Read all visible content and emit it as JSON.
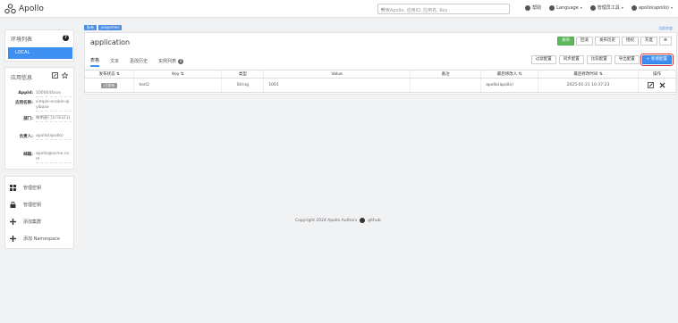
{
  "navbar": {
    "brand": "Apollo",
    "search_placeholder": "搜索Apollo, 应用ID, 应用名, Key",
    "links": [
      {
        "icon": "help-icon",
        "label": "帮助"
      },
      {
        "icon": "globe-icon",
        "label": "Language"
      },
      {
        "icon": "gear-icon",
        "label": "管理员工具"
      },
      {
        "icon": "user-icon",
        "label": "apollo(apollo)"
      }
    ]
  },
  "sidebar": {
    "env": {
      "title": "环境列表",
      "items": [
        "LOCAL"
      ]
    },
    "info": {
      "title": "应用信息",
      "rows": [
        {
          "key": "AppId:",
          "value": "1000044xxx"
        },
        {
          "key": "应用名称:",
          "value": "simple-enable-qiyibase"
        },
        {
          "key": "部门:",
          "value": "样例部门1(TEST1)"
        },
        {
          "key": "负责人:",
          "value": "apollo(apollo)"
        },
        {
          "key": "邮箱:",
          "value": "apollo@acme.com"
        }
      ]
    },
    "menu": [
      {
        "icon": "grid-icon",
        "label": "管理密钥"
      },
      {
        "icon": "lock-icon",
        "label": "管理密钥"
      },
      {
        "icon": "plus-icon",
        "label": "添加集群"
      },
      {
        "icon": "plus-icon",
        "label": "添加 Namespace"
      }
    ]
  },
  "main": {
    "tags": [
      "私有",
      "properties"
    ],
    "release_tag": "当前灰度",
    "title": "application",
    "top_buttons": [
      {
        "label": "发布",
        "style": "green"
      },
      {
        "label": "回滚",
        "style": "default"
      },
      {
        "label": "发布历史",
        "style": "default"
      },
      {
        "label": "授权",
        "style": "default"
      },
      {
        "label": "灰度",
        "style": "default"
      },
      {
        "label": "⚙",
        "style": "default"
      }
    ],
    "tabs": [
      {
        "label": "表格",
        "active": true
      },
      {
        "label": "文本",
        "active": false
      },
      {
        "label": "更改历史",
        "active": false
      },
      {
        "label": "实例列表",
        "active": false,
        "badge": "0"
      }
    ],
    "tab_buttons": [
      {
        "label": "过滤配置",
        "style": "default"
      },
      {
        "label": "同步配置",
        "style": "default"
      },
      {
        "label": "比较配置",
        "style": "default"
      },
      {
        "label": "导出配置",
        "style": "default"
      },
      {
        "label": "+ 新增配置",
        "style": "blue"
      }
    ],
    "table": {
      "headers": [
        "发布状态 ⇅",
        "Key ⇅",
        "类型",
        "Value",
        "备注",
        "最后修改人 ⇅",
        "最后修改时间 ⇅",
        "操作"
      ],
      "rows": [
        {
          "status": "已发布",
          "key": "test2",
          "type": "String",
          "value": "1001",
          "comment": "",
          "modifier": "apollo(apollo)",
          "time": "2025-01-21 10:37:23"
        }
      ]
    }
  },
  "footer": {
    "text": "Copyright 2024 Apollo Authors",
    "link": "github"
  }
}
